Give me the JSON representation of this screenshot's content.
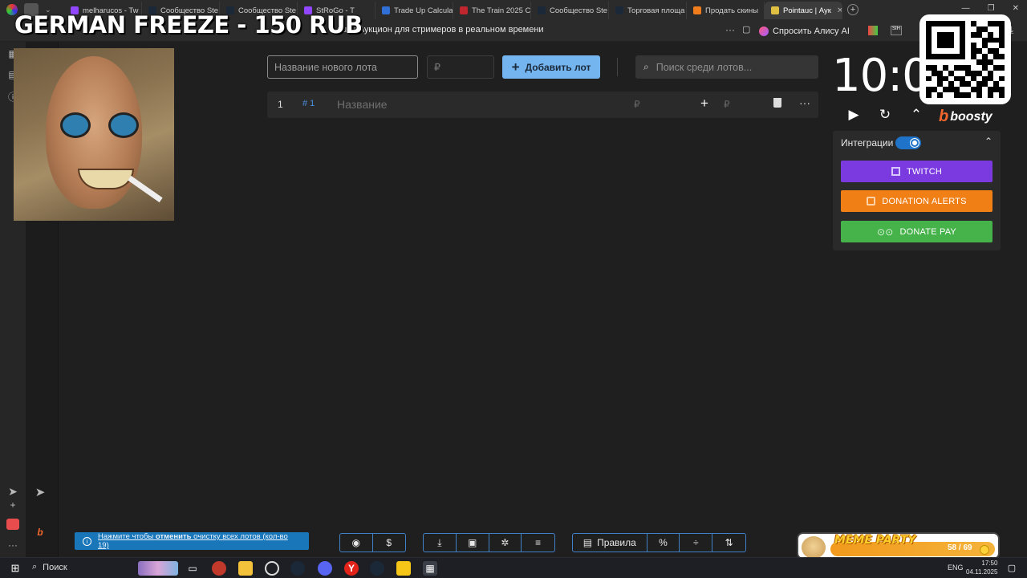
{
  "browser": {
    "tabs": [
      {
        "label": "melharucos - Tw",
        "color": "#9146ff"
      },
      {
        "label": "Сообщество Ste",
        "color": "#1b2838"
      },
      {
        "label": "Сообщество Ste",
        "color": "#1b2838"
      },
      {
        "label": "StRoGo - T",
        "color": "#9146ff"
      },
      {
        "label": "Trade Up Calcula",
        "color": "#2f6fd6"
      },
      {
        "label": "The Train 2025 C",
        "color": "#c0262d"
      },
      {
        "label": "Сообщество Ste",
        "color": "#1b2838"
      },
      {
        "label": "Торговая площа",
        "color": "#1b2838"
      },
      {
        "label": "Продать скины",
        "color": "#f07c1c"
      },
      {
        "label": "Pointauc | Аук",
        "color": "#e0c040",
        "active": true
      }
    ],
    "page_title": "auc | Аукцион для стримеров в реальном времени",
    "alice_button": "Спросить Алису AI"
  },
  "overlay": {
    "title": "GERMAN FREEZE - 150 RUB"
  },
  "auction": {
    "new_lot_placeholder": "Название нового лота",
    "price_placeholder": "₽",
    "add_button": "Добавить лот",
    "search_placeholder": "Поиск среди лотов...",
    "lots": [
      {
        "index": "1",
        "id": "# 1",
        "name_placeholder": "Название",
        "currency": "₽",
        "add_currency": "₽"
      }
    ]
  },
  "timer": {
    "value": "10:00"
  },
  "boosty": {
    "label": "boosty"
  },
  "integrations": {
    "label": "Интеграции",
    "enabled": true,
    "buttons": [
      {
        "label": "TWITCH",
        "color": "#7b3ae0"
      },
      {
        "label": "DONATION ALERTS",
        "color": "#f07f16"
      },
      {
        "label": "DONATE PAY",
        "color": "#46b24a"
      }
    ]
  },
  "bottom": {
    "notification": {
      "prefix": "Нажмите чтобы ",
      "bold": "отменить",
      "suffix": " очистку всех лотов (кол-во 19)"
    },
    "rules_label": "Правила"
  },
  "meme_party": {
    "title": "MEME PARTY",
    "count": "58 / 69"
  },
  "taskbar": {
    "search_label": "Поиск",
    "lang": "ENG",
    "time": "17:50",
    "date": "04.11.2025"
  },
  "colors": {
    "accent": "#74b4ef",
    "twitch": "#7b3ae0",
    "donation_alerts": "#f07f16",
    "donate_pay": "#46b24a"
  }
}
